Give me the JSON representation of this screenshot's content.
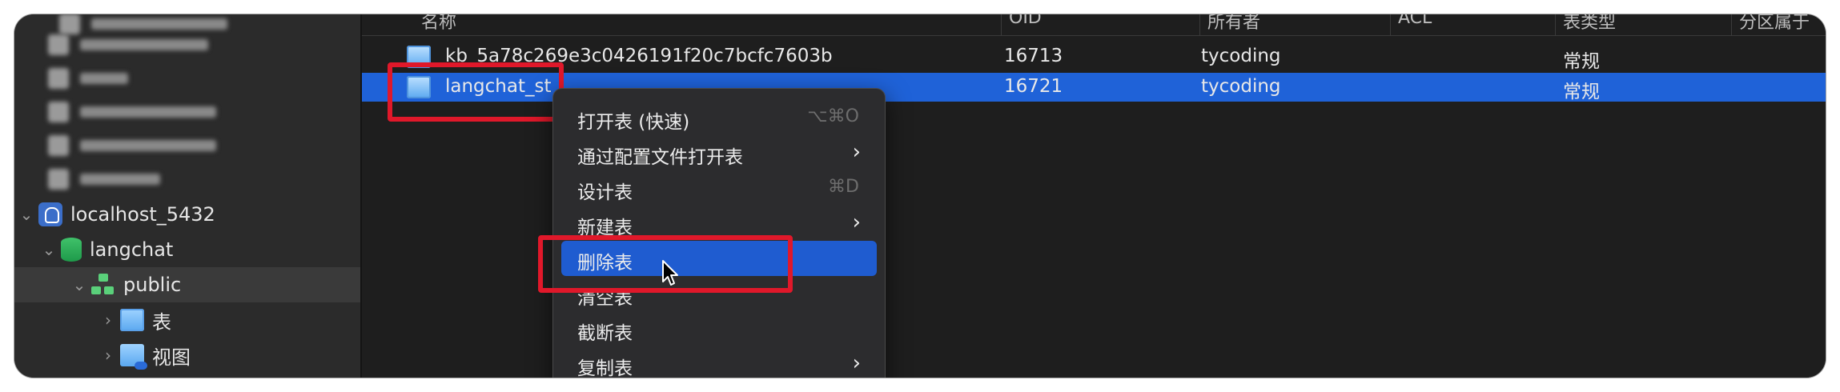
{
  "sidebar": {
    "items": [
      {
        "label": "localhost_5432"
      },
      {
        "label": "langchat"
      },
      {
        "label": "public"
      },
      {
        "label": "表"
      },
      {
        "label": "视图"
      }
    ]
  },
  "table": {
    "headers": [
      "名称",
      "OID",
      "所有者",
      "ACL",
      "表类型",
      "分区属于"
    ],
    "rows": [
      {
        "name": "kb_5a78c269e3c0426191f20c7bcfc7603b",
        "oid": "16713",
        "owner": "tycoding",
        "type": "常规"
      },
      {
        "name": "langchat_st",
        "oid": "16721",
        "owner": "tycoding",
        "type": "常规"
      }
    ]
  },
  "context_menu": {
    "items": [
      {
        "label": "打开表 (快速)",
        "shortcut": "⌥⌘O"
      },
      {
        "label": "通过配置文件打开表",
        "submenu": "›"
      },
      {
        "label": "设计表",
        "shortcut": "⌘D"
      },
      {
        "label": "新建表",
        "submenu": "›"
      },
      {
        "label": "删除表"
      },
      {
        "label": "清空表"
      },
      {
        "label": "截断表"
      },
      {
        "label": "复制表",
        "submenu": "›"
      }
    ]
  },
  "colors": {
    "selection": "#1f62d8",
    "highlight_box": "#e0182a"
  }
}
